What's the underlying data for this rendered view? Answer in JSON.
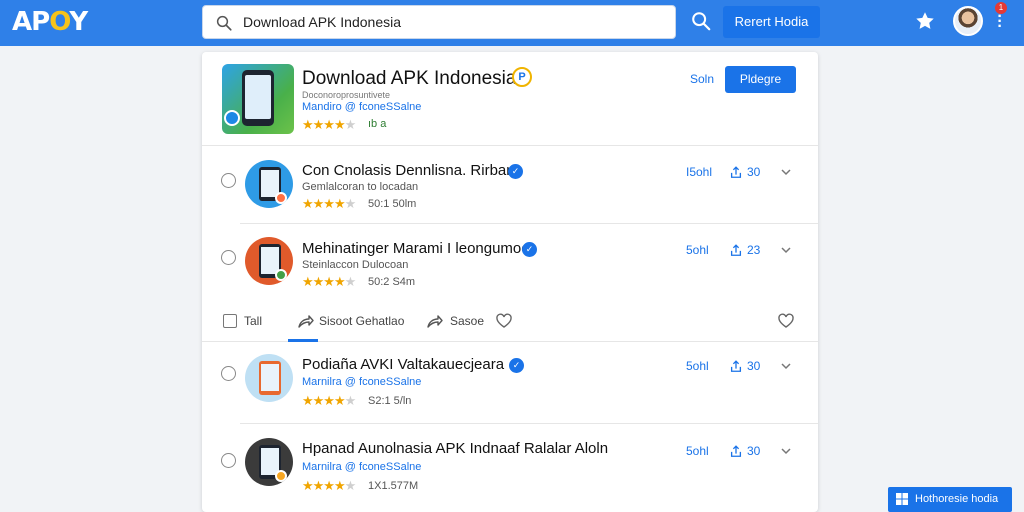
{
  "brand": {
    "logo_prefix": "AP",
    "logo_o": "O",
    "logo_suffix": "Y"
  },
  "search": {
    "value": "Download APK Indonesia"
  },
  "header": {
    "cta_label": "Rerert Hodia",
    "notification_count": "1"
  },
  "featured": {
    "title": "Download APK Indonesia",
    "subtitle": "Doconoroprosuntivete",
    "developer": "Mandiro @ fconeSSalne",
    "rating_text": "★★★★",
    "rating_half": "★",
    "meta": "ıb a",
    "link_label": "Soln",
    "button_label": "Pldegre"
  },
  "results": [
    {
      "title": "Con Cnolasis Dennlisna. Rirbant",
      "subtitle": "Gemlalcoran to locadan",
      "sub_style": "gray",
      "rating_text": "★★★★",
      "rating_half": "★",
      "size": "50:1 50lm",
      "link_label": "I5ohl",
      "count": "30"
    },
    {
      "title": "Mehinatinger Marami I leongumoor",
      "subtitle": "Steinlaccon Dulocoan",
      "sub_style": "gray",
      "rating_text": "★★★★",
      "rating_half": "★",
      "size": "50:2 S4m",
      "link_label": "5ohl",
      "count": "23"
    },
    {
      "title": "Podiaña AVKI Valtakauecjeara",
      "subtitle": "Marnilra @ fconeSSalne",
      "sub_style": "blue",
      "rating_text": "★★★★",
      "rating_half": "★",
      "size": "S2:1 5/ln",
      "link_label": "5ohl",
      "count": "30"
    },
    {
      "title": "Hpanad Aunolnasia APK Indnaaf Ralalar Aloln",
      "subtitle": "Marnilra @ fconeSSalne",
      "sub_style": "blue",
      "rating_text": "★★★★",
      "rating_half": "★",
      "size": "1X1.577M",
      "link_label": "5ohl",
      "count": "30"
    }
  ],
  "actionbar": {
    "checkbox_label": "Tall",
    "share_label": "Sisoot Gehatlao",
    "save_label": "Sasoe"
  },
  "float_button": {
    "label": "Hothoresie hodia"
  },
  "colors": {
    "accent": "#1a73e8",
    "header": "#2f80e8",
    "star": "#f0a500",
    "logo_accent": "#f6c31a"
  }
}
